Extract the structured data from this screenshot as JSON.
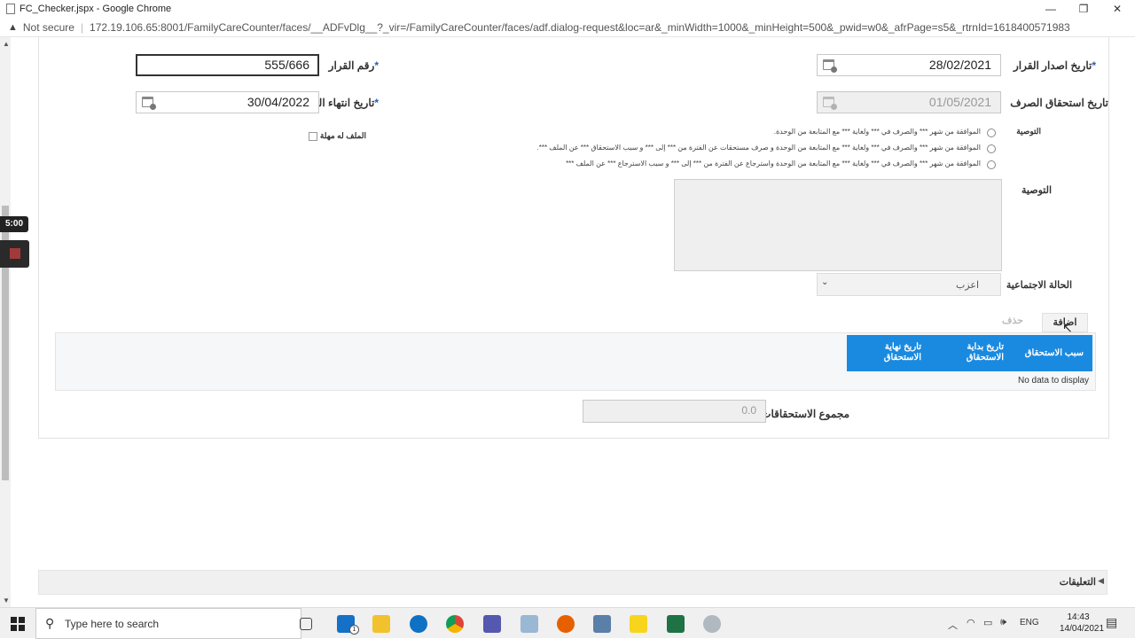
{
  "window": {
    "title": "FC_Checker.jspx - Google Chrome",
    "minimize": "—",
    "maximize": "❐",
    "close": "✕"
  },
  "address": {
    "security": "Not secure",
    "url": "172.19.106.65:8001/FamilyCareCounter/faces/__ADFvDlg__?_vir=/FamilyCareCounter/faces/adf.dialog-request&loc=ar&_minWidth=1000&_minHeight=500&_pwid=w0&_afrPage=s5&_rtrnId=1618400571983"
  },
  "overlay": {
    "timer": "5:00"
  },
  "form": {
    "decision_date_label": "تاريخ اصدار القرار",
    "decision_date_value": "28/02/2021",
    "decision_no_label": "رقم القرار",
    "decision_no_value": "555/666",
    "entitlement_date_label": "تاريخ استحقاق الصرف",
    "entitlement_date_value": "01/05/2021",
    "grace_end_label": "تاريخ انتهاء المهلة",
    "grace_end_value": "30/04/2022",
    "required_mark": "*",
    "recommendation_label": "التوصية",
    "radio_options": [
      "الموافقة من شهر *** والصرف في *** ولغاية *** مع المتابعة من الوحدة.",
      "الموافقة من شهر *** والصرف في *** ولغاية *** مع المتابعة من الوحدة و صرف مستحقات عن الفترة من *** إلى *** و سبب الاستحقاق *** عن الملف ***.",
      "الموافقة من شهر *** والصرف في *** ولغاية *** مع المتابعة من الوحدة واسترجاع عن الفترة من *** إلى *** و سبب الاسترجاع *** عن الملف ***"
    ],
    "grace_checkbox_label": "الملف له مهلة",
    "recommendation_text_label": "التوصية",
    "social_status_label": "الحالة الاجتماعية",
    "social_status_value": "اعزب",
    "add_button": "اضافة",
    "delete_button": "حذف",
    "table_headers": [
      "سبب الاستحقاق",
      "تاريخ بداية الاستحقاق",
      "تاريخ نهاية الاستحقاق"
    ],
    "table_empty": "No data to display",
    "total_label": "مجموع الاستحقاقات",
    "total_value": "0.0",
    "comments_label": "التعليقات"
  },
  "taskbar": {
    "search_placeholder": "Type here to search",
    "language": "ENG",
    "time": "14:43",
    "date": "14/04/2021",
    "mail_badge": "1"
  },
  "colors": {
    "table_header": "#1a8ae0",
    "required": "#1f5fb5"
  }
}
